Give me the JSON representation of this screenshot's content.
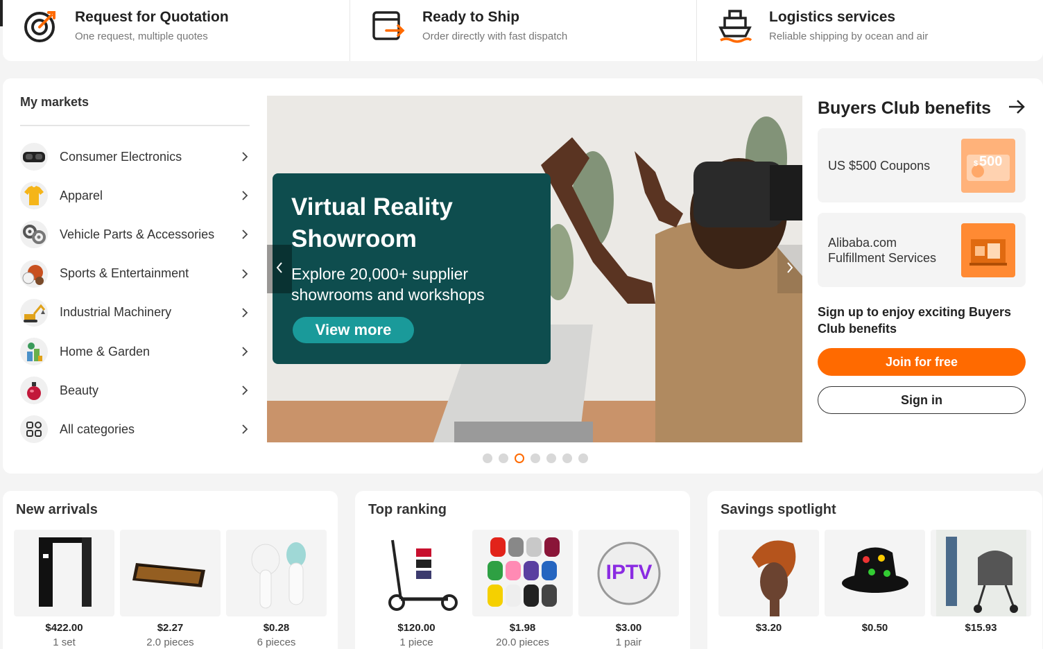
{
  "services": [
    {
      "title": "Request for Quotation",
      "subtitle": "One request, multiple quotes",
      "icon": "target-icon"
    },
    {
      "title": "Ready to Ship",
      "subtitle": "Order directly with fast dispatch",
      "icon": "dispatch-icon"
    },
    {
      "title": "Logistics services",
      "subtitle": "Reliable shipping by ocean and air",
      "icon": "ship-icon"
    }
  ],
  "markets": {
    "title": "My markets",
    "items": [
      {
        "label": "Consumer Electronics",
        "icon": "vr-headset-icon"
      },
      {
        "label": "Apparel",
        "icon": "tshirt-icon"
      },
      {
        "label": "Vehicle Parts & Accessories",
        "icon": "gear-parts-icon"
      },
      {
        "label": "Sports & Entertainment",
        "icon": "sports-balls-icon"
      },
      {
        "label": "Industrial Machinery",
        "icon": "excavator-icon"
      },
      {
        "label": "Home & Garden",
        "icon": "home-garden-icon"
      },
      {
        "label": "Beauty",
        "icon": "perfume-icon"
      },
      {
        "label": "All categories",
        "icon": "grid-icon"
      }
    ]
  },
  "banner": {
    "headline_1": "Virtual Reality",
    "headline_2": "Showroom",
    "text_1": "Explore 20,000+ supplier",
    "text_2": "showrooms and workshops",
    "button": "View more",
    "slides": 7,
    "active_slide": 3
  },
  "club": {
    "title": "Buyers Club benefits",
    "benefits": [
      {
        "label": "US $500 Coupons",
        "badge": "500",
        "badge_prefix": "$"
      },
      {
        "label": "Alibaba.com Fulfillment Services"
      }
    ],
    "signup_text": "Sign up to enjoy exciting Buyers Club benefits",
    "join_label": "Join for free",
    "signin_label": "Sign in"
  },
  "sections": [
    {
      "title": "New arrivals",
      "products": [
        {
          "price": "$422.00",
          "qty": "1 set"
        },
        {
          "price": "$2.27",
          "qty": "2.0 pieces"
        },
        {
          "price": "$0.28",
          "qty": "6 pieces"
        }
      ]
    },
    {
      "title": "Top ranking",
      "products": [
        {
          "price": "$120.00",
          "qty": "1 piece"
        },
        {
          "price": "$1.98",
          "qty": "20.0 pieces"
        },
        {
          "price": "$3.00",
          "qty": "1 pair"
        }
      ]
    },
    {
      "title": "Savings spotlight",
      "products": [
        {
          "price": "$3.20",
          "qty": ""
        },
        {
          "price": "$0.50",
          "qty": ""
        },
        {
          "price": "$15.93",
          "qty": ""
        }
      ]
    }
  ],
  "colors": {
    "accent": "#ff6a00",
    "promo_bg": "#0e4d4e",
    "promo_button": "#1a9a9a"
  }
}
